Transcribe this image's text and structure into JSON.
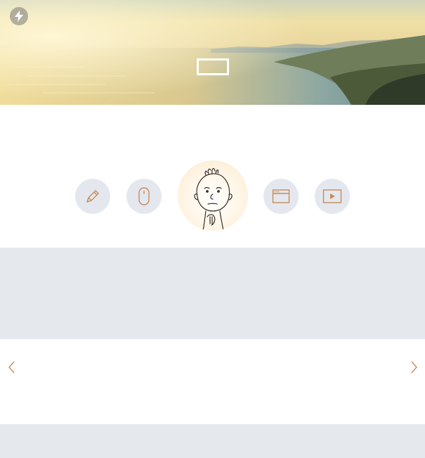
{
  "hero": {
    "bolt_icon": "lightning-bolt-icon",
    "logo_box_icon": "outlined-rectangle-logo"
  },
  "icon_row": {
    "items": [
      {
        "icon": "pencil-icon"
      },
      {
        "icon": "mouse-icon"
      },
      {
        "icon": "cartoon-avatar"
      },
      {
        "icon": "browser-window-icon"
      },
      {
        "icon": "play-video-icon"
      }
    ]
  },
  "slider": {
    "prev_icon": "chevron-left-icon",
    "next_icon": "chevron-right-icon"
  },
  "colors": {
    "accent": "#c98a5a",
    "circle_bg": "#e4e8ee",
    "band_bg": "#e5e9ee"
  }
}
